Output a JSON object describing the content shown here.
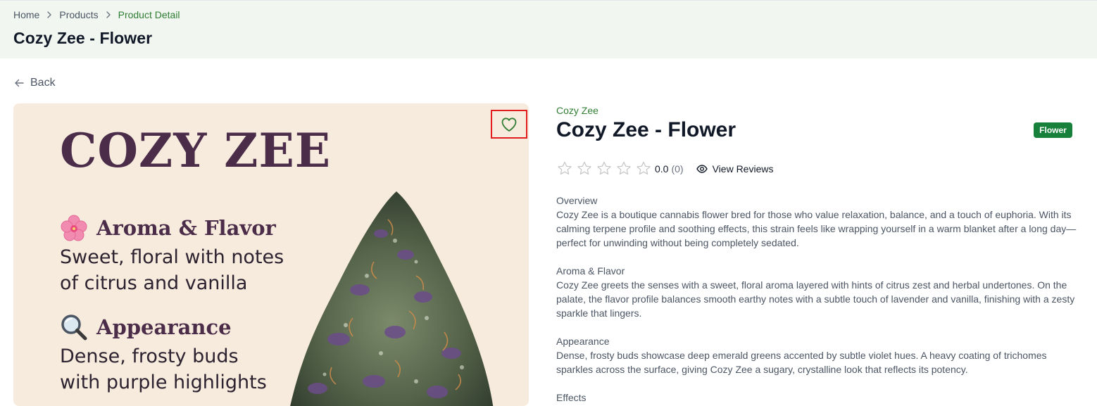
{
  "breadcrumb": {
    "items": [
      "Home",
      "Products",
      "Product Detail"
    ]
  },
  "page": {
    "title": "Cozy Zee - Flower",
    "back_label": "Back"
  },
  "image": {
    "brand_text": "COZY ZEE",
    "sections": [
      {
        "title": "Aroma & Flavor",
        "icon": "flower-emoji",
        "lines": [
          "Sweet, floral with notes",
          "of citrus and vanilla"
        ]
      },
      {
        "title": "Appearance",
        "icon": "magnifier-emoji",
        "lines": [
          "Dense, frosty buds",
          "with purple highlights"
        ]
      }
    ]
  },
  "favorite": {
    "icon": "heart-icon",
    "active": false
  },
  "product": {
    "brand": "Cozy Zee",
    "name": "Cozy Zee - Flower",
    "category_badge": "Flower",
    "rating": {
      "value": "0.0",
      "count": "(0)",
      "stars_filled": 0,
      "stars_total": 5
    },
    "view_reviews_label": "View Reviews"
  },
  "description": [
    {
      "heading": "Overview",
      "body": "Cozy Zee is a boutique cannabis flower bred for those who value relaxation, balance, and a touch of euphoria. With its calming terpene profile and soothing effects, this strain feels like wrapping yourself in a warm blanket after a long day—perfect for unwinding without being completely sedated."
    },
    {
      "heading": "Aroma & Flavor",
      "body": "Cozy Zee greets the senses with a sweet, floral aroma layered with hints of citrus zest and herbal undertones. On the palate, the flavor profile balances smooth earthy notes with a subtle touch of lavender and vanilla, finishing with a zesty sparkle that lingers."
    },
    {
      "heading": "Appearance",
      "body": "Dense, frosty buds showcase deep emerald greens accented by subtle violet hues. A heavy coating of trichomes sparkles across the surface, giving Cozy Zee a sugary, crystalline look that reflects its potency."
    },
    {
      "heading": "Effects",
      "body": ""
    }
  ],
  "colors": {
    "accent_green": "#2e7d32",
    "badge_green": "#17803a",
    "image_bg": "#f7ebdd",
    "image_text": "#4b2d4a",
    "highlight_red": "#e11d1d"
  }
}
